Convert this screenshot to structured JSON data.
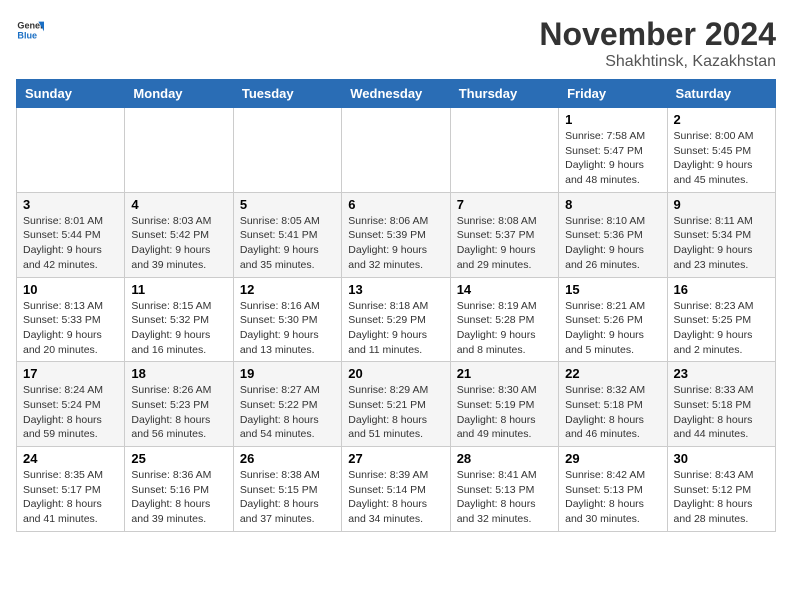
{
  "logo": {
    "general": "General",
    "blue": "Blue"
  },
  "header": {
    "month_year": "November 2024",
    "location": "Shakhtinsk, Kazakhstan"
  },
  "weekdays": [
    "Sunday",
    "Monday",
    "Tuesday",
    "Wednesday",
    "Thursday",
    "Friday",
    "Saturday"
  ],
  "weeks": [
    [
      null,
      null,
      null,
      null,
      null,
      {
        "day": "1",
        "sunrise": "Sunrise: 7:58 AM",
        "sunset": "Sunset: 5:47 PM",
        "daylight": "Daylight: 9 hours and 48 minutes."
      },
      {
        "day": "2",
        "sunrise": "Sunrise: 8:00 AM",
        "sunset": "Sunset: 5:45 PM",
        "daylight": "Daylight: 9 hours and 45 minutes."
      }
    ],
    [
      {
        "day": "3",
        "sunrise": "Sunrise: 8:01 AM",
        "sunset": "Sunset: 5:44 PM",
        "daylight": "Daylight: 9 hours and 42 minutes."
      },
      {
        "day": "4",
        "sunrise": "Sunrise: 8:03 AM",
        "sunset": "Sunset: 5:42 PM",
        "daylight": "Daylight: 9 hours and 39 minutes."
      },
      {
        "day": "5",
        "sunrise": "Sunrise: 8:05 AM",
        "sunset": "Sunset: 5:41 PM",
        "daylight": "Daylight: 9 hours and 35 minutes."
      },
      {
        "day": "6",
        "sunrise": "Sunrise: 8:06 AM",
        "sunset": "Sunset: 5:39 PM",
        "daylight": "Daylight: 9 hours and 32 minutes."
      },
      {
        "day": "7",
        "sunrise": "Sunrise: 8:08 AM",
        "sunset": "Sunset: 5:37 PM",
        "daylight": "Daylight: 9 hours and 29 minutes."
      },
      {
        "day": "8",
        "sunrise": "Sunrise: 8:10 AM",
        "sunset": "Sunset: 5:36 PM",
        "daylight": "Daylight: 9 hours and 26 minutes."
      },
      {
        "day": "9",
        "sunrise": "Sunrise: 8:11 AM",
        "sunset": "Sunset: 5:34 PM",
        "daylight": "Daylight: 9 hours and 23 minutes."
      }
    ],
    [
      {
        "day": "10",
        "sunrise": "Sunrise: 8:13 AM",
        "sunset": "Sunset: 5:33 PM",
        "daylight": "Daylight: 9 hours and 20 minutes."
      },
      {
        "day": "11",
        "sunrise": "Sunrise: 8:15 AM",
        "sunset": "Sunset: 5:32 PM",
        "daylight": "Daylight: 9 hours and 16 minutes."
      },
      {
        "day": "12",
        "sunrise": "Sunrise: 8:16 AM",
        "sunset": "Sunset: 5:30 PM",
        "daylight": "Daylight: 9 hours and 13 minutes."
      },
      {
        "day": "13",
        "sunrise": "Sunrise: 8:18 AM",
        "sunset": "Sunset: 5:29 PM",
        "daylight": "Daylight: 9 hours and 11 minutes."
      },
      {
        "day": "14",
        "sunrise": "Sunrise: 8:19 AM",
        "sunset": "Sunset: 5:28 PM",
        "daylight": "Daylight: 9 hours and 8 minutes."
      },
      {
        "day": "15",
        "sunrise": "Sunrise: 8:21 AM",
        "sunset": "Sunset: 5:26 PM",
        "daylight": "Daylight: 9 hours and 5 minutes."
      },
      {
        "day": "16",
        "sunrise": "Sunrise: 8:23 AM",
        "sunset": "Sunset: 5:25 PM",
        "daylight": "Daylight: 9 hours and 2 minutes."
      }
    ],
    [
      {
        "day": "17",
        "sunrise": "Sunrise: 8:24 AM",
        "sunset": "Sunset: 5:24 PM",
        "daylight": "Daylight: 8 hours and 59 minutes."
      },
      {
        "day": "18",
        "sunrise": "Sunrise: 8:26 AM",
        "sunset": "Sunset: 5:23 PM",
        "daylight": "Daylight: 8 hours and 56 minutes."
      },
      {
        "day": "19",
        "sunrise": "Sunrise: 8:27 AM",
        "sunset": "Sunset: 5:22 PM",
        "daylight": "Daylight: 8 hours and 54 minutes."
      },
      {
        "day": "20",
        "sunrise": "Sunrise: 8:29 AM",
        "sunset": "Sunset: 5:21 PM",
        "daylight": "Daylight: 8 hours and 51 minutes."
      },
      {
        "day": "21",
        "sunrise": "Sunrise: 8:30 AM",
        "sunset": "Sunset: 5:19 PM",
        "daylight": "Daylight: 8 hours and 49 minutes."
      },
      {
        "day": "22",
        "sunrise": "Sunrise: 8:32 AM",
        "sunset": "Sunset: 5:18 PM",
        "daylight": "Daylight: 8 hours and 46 minutes."
      },
      {
        "day": "23",
        "sunrise": "Sunrise: 8:33 AM",
        "sunset": "Sunset: 5:18 PM",
        "daylight": "Daylight: 8 hours and 44 minutes."
      }
    ],
    [
      {
        "day": "24",
        "sunrise": "Sunrise: 8:35 AM",
        "sunset": "Sunset: 5:17 PM",
        "daylight": "Daylight: 8 hours and 41 minutes."
      },
      {
        "day": "25",
        "sunrise": "Sunrise: 8:36 AM",
        "sunset": "Sunset: 5:16 PM",
        "daylight": "Daylight: 8 hours and 39 minutes."
      },
      {
        "day": "26",
        "sunrise": "Sunrise: 8:38 AM",
        "sunset": "Sunset: 5:15 PM",
        "daylight": "Daylight: 8 hours and 37 minutes."
      },
      {
        "day": "27",
        "sunrise": "Sunrise: 8:39 AM",
        "sunset": "Sunset: 5:14 PM",
        "daylight": "Daylight: 8 hours and 34 minutes."
      },
      {
        "day": "28",
        "sunrise": "Sunrise: 8:41 AM",
        "sunset": "Sunset: 5:13 PM",
        "daylight": "Daylight: 8 hours and 32 minutes."
      },
      {
        "day": "29",
        "sunrise": "Sunrise: 8:42 AM",
        "sunset": "Sunset: 5:13 PM",
        "daylight": "Daylight: 8 hours and 30 minutes."
      },
      {
        "day": "30",
        "sunrise": "Sunrise: 8:43 AM",
        "sunset": "Sunset: 5:12 PM",
        "daylight": "Daylight: 8 hours and 28 minutes."
      }
    ]
  ]
}
